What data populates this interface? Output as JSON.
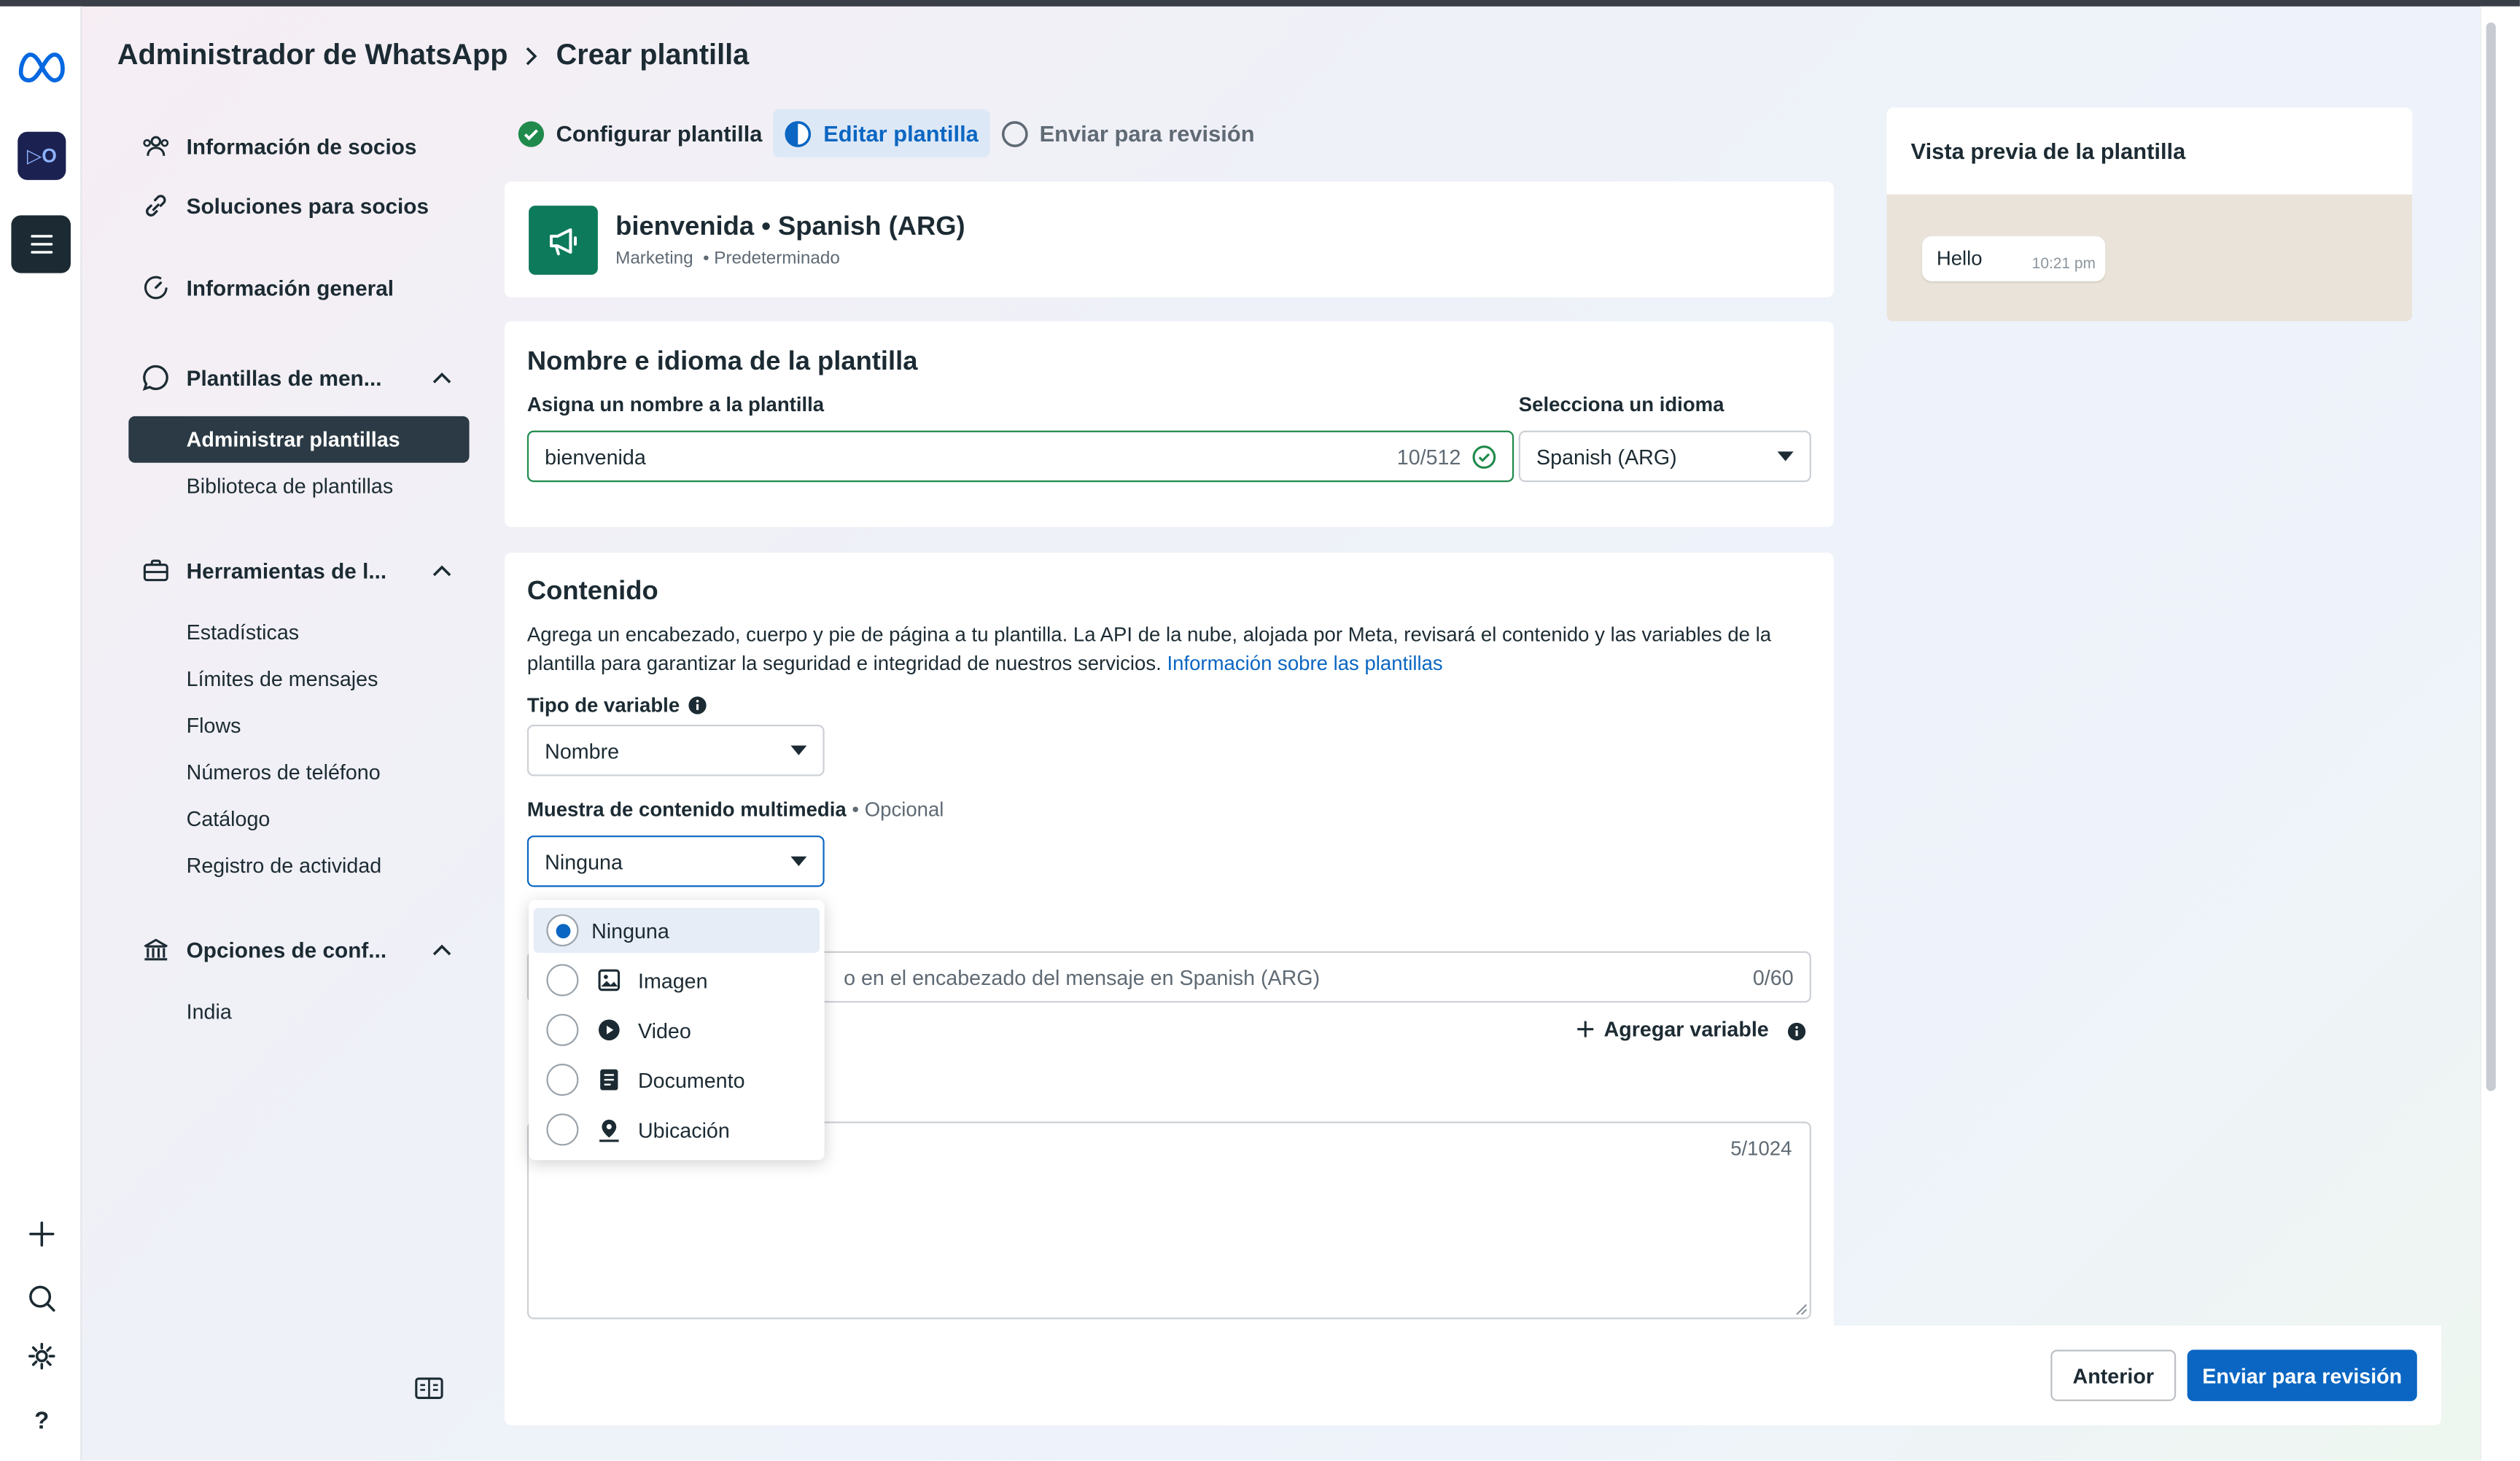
{
  "breadcrumb": {
    "root": "Administrador de WhatsApp",
    "current": "Crear plantilla"
  },
  "rail": {
    "app_badge": "▷O",
    "help": "?"
  },
  "sidebar": {
    "items": [
      {
        "label": "Información de socios",
        "icon": "people-icon"
      },
      {
        "label": "Soluciones para socios",
        "icon": "link-icon"
      },
      {
        "label": "Información general",
        "icon": "gauge-icon"
      }
    ],
    "sections": [
      {
        "label": "Plantillas de men...",
        "icon": "chat-icon",
        "children": [
          "Administrar plantillas",
          "Biblioteca de plantillas"
        ],
        "active": "Administrar plantillas"
      },
      {
        "label": "Herramientas de l...",
        "icon": "toolbox-icon",
        "children": [
          "Estadísticas",
          "Límites de mensajes",
          "Flows",
          "Números de teléfono",
          "Catálogo",
          "Registro de actividad"
        ]
      },
      {
        "label": "Opciones de conf...",
        "icon": "bank-icon",
        "children": [
          "India"
        ]
      }
    ]
  },
  "steps": [
    {
      "label": "Configurar plantilla",
      "state": "done"
    },
    {
      "label": "Editar plantilla",
      "state": "current"
    },
    {
      "label": "Enviar para revisión",
      "state": "pending"
    }
  ],
  "template_header": {
    "title": "bienvenida • Spanish (ARG)",
    "category": "Marketing",
    "subtype": "• Predeterminado"
  },
  "name_section": {
    "title": "Nombre e idioma de la plantilla",
    "name_label": "Asigna un nombre a la plantilla",
    "name_value": "bienvenida",
    "name_count": "10/512",
    "lang_label": "Selecciona un idioma",
    "lang_value": "Spanish (ARG)"
  },
  "content_section": {
    "title": "Contenido",
    "description": "Agrega un encabezado, cuerpo y pie de página a tu plantilla. La API de la nube, alojada por Meta, revisará el contenido y las variables de la plantilla para garantizar la seguridad e integridad de nuestros servicios. ",
    "link": "Información sobre las plantillas",
    "variable_type_label": "Tipo de variable",
    "variable_type_value": "Nombre",
    "media_label": "Muestra de contenido multimedia",
    "media_optional": "• Opcional",
    "media_value": "Ninguna",
    "header_placeholder_visible": "o en el encabezado del mensaje en Spanish (ARG)",
    "header_count": "0/60",
    "add_variable": "Agregar variable",
    "body_count": "5/1024"
  },
  "media_options": [
    {
      "label": "Ninguna",
      "icon": "",
      "selected": true
    },
    {
      "label": "Imagen",
      "icon": "image-icon",
      "selected": false
    },
    {
      "label": "Video",
      "icon": "play-icon",
      "selected": false
    },
    {
      "label": "Documento",
      "icon": "document-icon",
      "selected": false
    },
    {
      "label": "Ubicación",
      "icon": "location-icon",
      "selected": false
    }
  ],
  "preview": {
    "title": "Vista previa de la plantilla",
    "message": "Hello",
    "time": "10:21 pm"
  },
  "footer": {
    "back": "Anterior",
    "submit": "Enviar para revisión"
  },
  "colors": {
    "primary": "#0a66c2",
    "success": "#1f8a4c",
    "template_icon_bg": "#0e7a5c",
    "sidebar_active": "#2b3a44"
  }
}
